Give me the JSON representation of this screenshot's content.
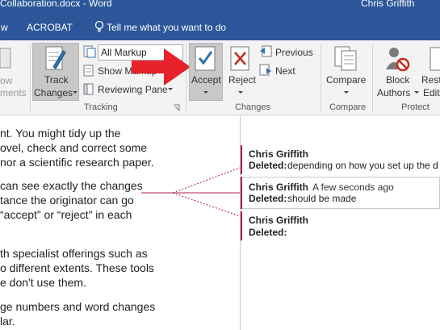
{
  "titlebar": {
    "doc_title": "Collaboration.docx - Word",
    "user": "Chris Griffith"
  },
  "menu": {
    "tab_partial": "w",
    "tab_acrobat": "ACROBAT",
    "tell_me": "Tell me what you want to do"
  },
  "ribbon": {
    "show_partial": "ow",
    "comments_partial": "ments",
    "track_changes": "Track",
    "track_changes2": "Changes",
    "markup_select": "All Markup",
    "show_markup": "Show Markup",
    "reviewing_pane": "Reviewing Pane",
    "tracking_group": "Tracking",
    "accept": "Accept",
    "reject": "Reject",
    "previous": "Previous",
    "next": "Next",
    "changes_group": "Changes",
    "compare": "Compare",
    "compare_group": "Compare",
    "block": "Block",
    "authors": "Authors",
    "restrict_partial": "Rest",
    "editing_partial": "Editi",
    "protect_group": "Protect"
  },
  "document": {
    "lines": [
      "nt. You might tidy up the",
      "ovel, check and correct some",
      "nor a scientific research paper.",
      "can see exactly the changes",
      "tance the originator can go",
      "“accept” or “reject” in each",
      "th specialist offerings such as",
      "o different extents. These tools",
      "e don't use them.",
      "ge numbers and word changes",
      "lar."
    ]
  },
  "comments": [
    {
      "author": "Chris Griffith",
      "time": "",
      "label": "Deleted:",
      "text": "depending on how you set up the d"
    },
    {
      "author": "Chris Griffith",
      "time": "A few seconds ago",
      "label": "Deleted:",
      "text": "should be made"
    },
    {
      "author": "Chris Griffith",
      "time": "",
      "label": "Deleted:",
      "text": ""
    }
  ],
  "colors": {
    "accent": "#2b579a",
    "track_change": "#a9204f",
    "arrow": "#e8222a",
    "check": "#2e74b5"
  }
}
